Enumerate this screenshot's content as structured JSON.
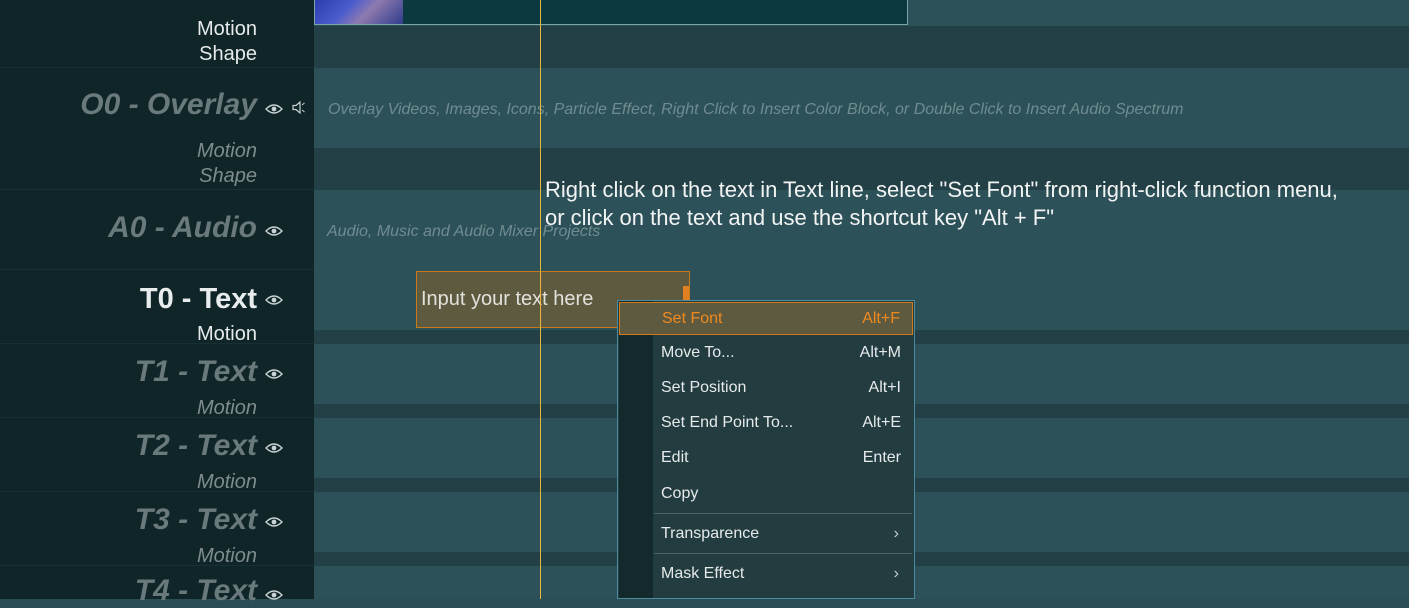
{
  "tracks": {
    "top_partial": {
      "motion": "Motion",
      "shape": "Shape"
    },
    "overlay": {
      "title": "O0 - Overlay",
      "motion": "Motion",
      "shape": "Shape",
      "hint": "Overlay Videos, Images, Icons, Particle Effect, Right Click to Insert Color Block, or Double Click to Insert Audio Spectrum"
    },
    "audio": {
      "title": "A0 - Audio",
      "hint": "Audio, Music and Audio Mixer Projects"
    },
    "text0": {
      "title": "T0 - Text",
      "motion": "Motion",
      "clip_text": "Input your text here"
    },
    "text1": {
      "title": "T1 - Text",
      "motion": "Motion"
    },
    "text2": {
      "title": "T2 - Text",
      "motion": "Motion"
    },
    "text3": {
      "title": "T3 - Text",
      "motion": "Motion"
    },
    "text4": {
      "title": "T4 - Text"
    }
  },
  "tooltip": {
    "line1": "Right click on the text in Text line, select \"Set Font\" from right-click function menu,",
    "line2": "or click on the text and use the shortcut key \"Alt + F\""
  },
  "context_menu": {
    "items": [
      {
        "label": "Set Font",
        "shortcut": "Alt+F"
      },
      {
        "label": "Move  To...",
        "shortcut": "Alt+M"
      },
      {
        "label": "Set Position",
        "shortcut": "Alt+I"
      },
      {
        "label": "Set End Point To...",
        "shortcut": "Alt+E"
      },
      {
        "label": "Edit",
        "shortcut": "Enter"
      },
      {
        "label": "Copy",
        "shortcut": ""
      },
      {
        "label": "Transparence",
        "shortcut": ""
      },
      {
        "label": "Mask Effect",
        "shortcut": ""
      }
    ],
    "submenu_arrow": "›"
  },
  "icons": {
    "eye": "eye-icon",
    "speaker": "speaker-icon"
  },
  "colors": {
    "accent": "#f08a1e",
    "playhead": "#e9b83a",
    "menu_border": "#4a8ba0"
  }
}
